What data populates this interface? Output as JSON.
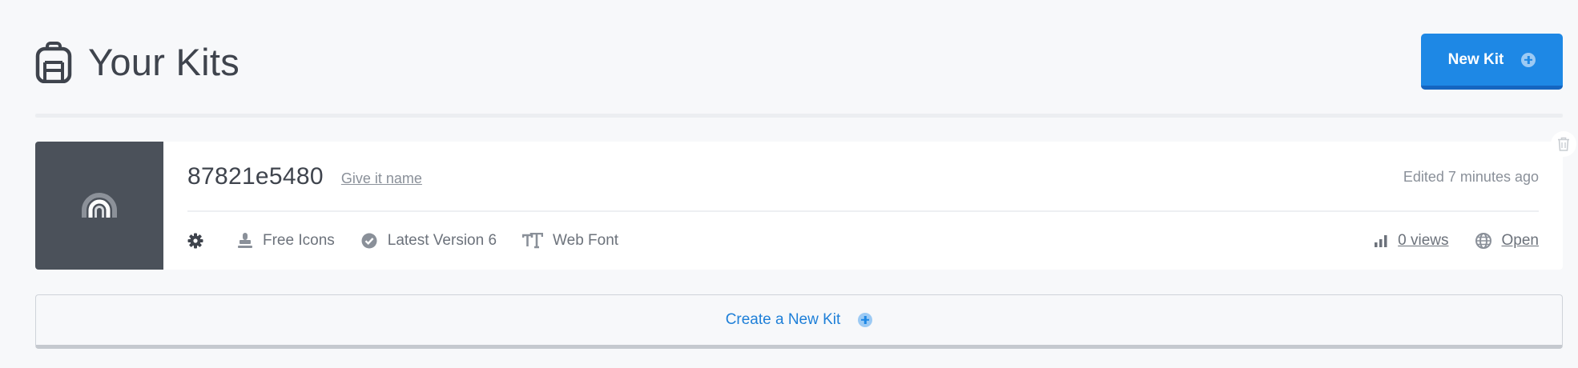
{
  "header": {
    "title": "Your Kits",
    "icon": "backpack-icon",
    "new_kit_label": "New Kit"
  },
  "kits": [
    {
      "id": "87821e5480",
      "name_link": "Give it name",
      "edited": "Edited 7 minutes ago",
      "thumb_icon": "rainbow-icon",
      "meta": {
        "license": "Free Icons",
        "version": "Latest Version 6",
        "tech": "Web Font",
        "views": "0 views",
        "visibility": "Open"
      }
    }
  ],
  "create_kit_label": "Create a New Kit",
  "colors": {
    "accent": "#1e88e5",
    "thumb_bg": "#4b515a",
    "page_bg": "#f7f8fa"
  }
}
